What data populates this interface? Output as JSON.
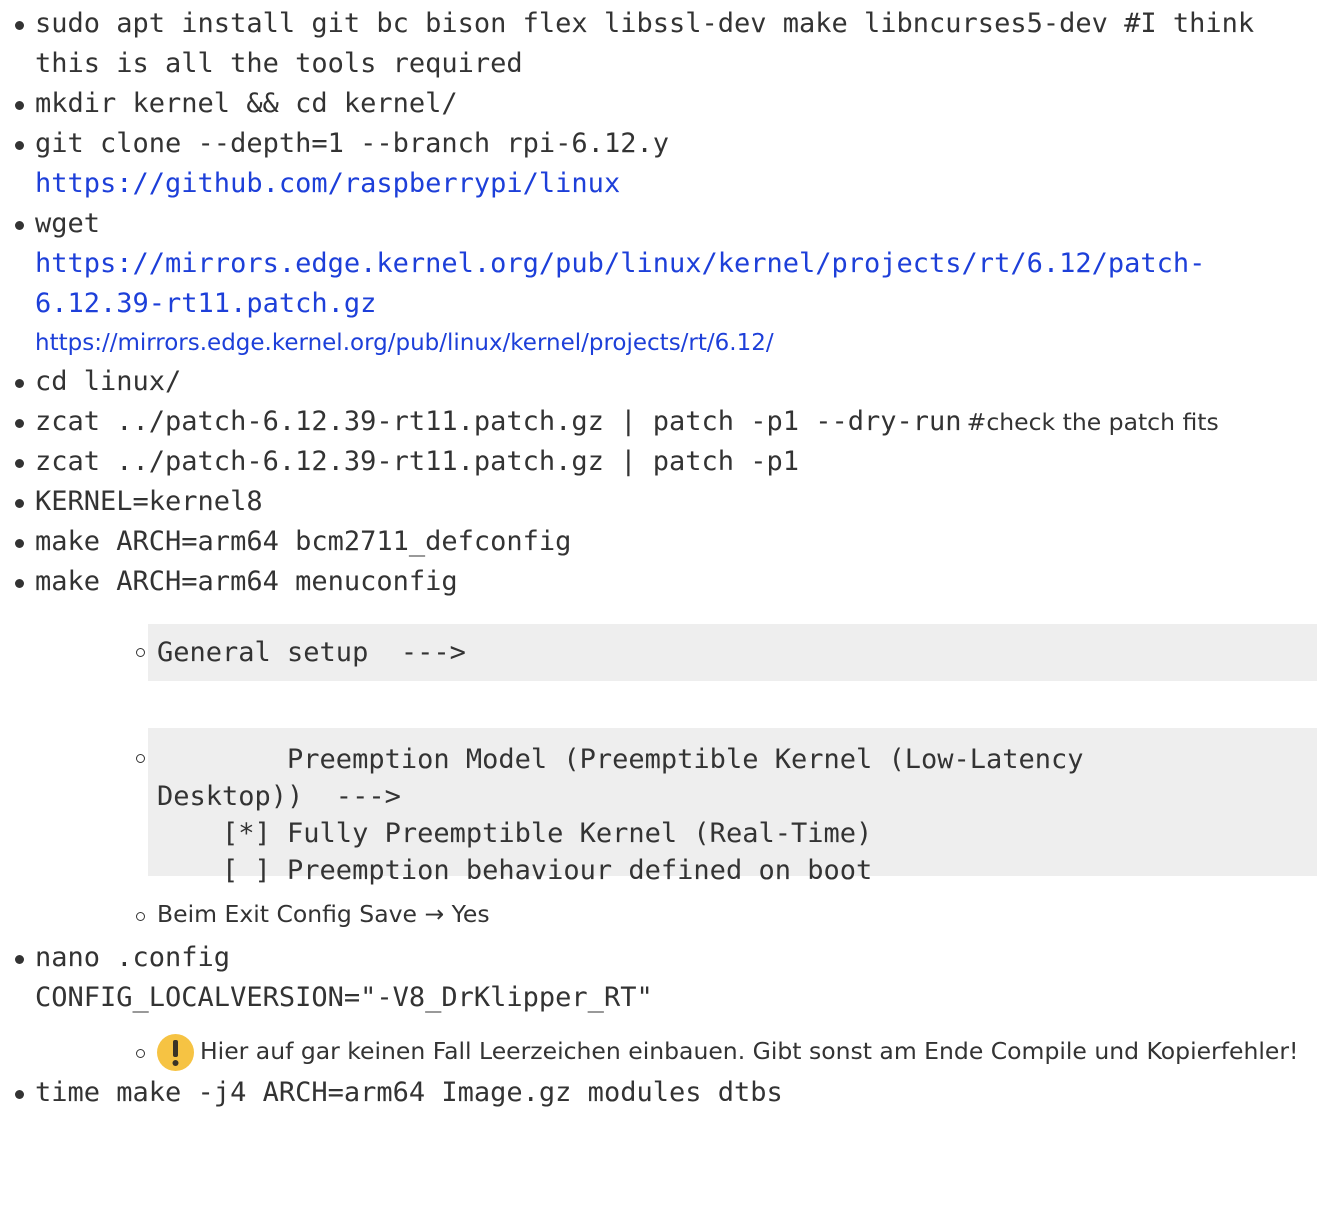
{
  "colors": {
    "link": "#1d3fd9",
    "text": "#333333",
    "code_bg": "#eeeeee",
    "warning_icon": "#f6c343"
  },
  "steps": [
    {
      "text": "sudo apt install git bc bison flex libssl-dev make libncurses5-dev #I think this is all the tools required"
    },
    {
      "text": "mkdir kernel && cd kernel/"
    },
    {
      "text": "git clone --depth=1 --branch rpi-6.12.y",
      "link": "https://github.com/raspberrypi/linux"
    },
    {
      "text": "wget",
      "link": "https://mirrors.edge.kernel.org/pub/linux/kernel/projects/rt/6.12/patch-6.12.39-rt11.patch.gz",
      "link2": "https://mirrors.edge.kernel.org/pub/linux/kernel/projects/rt/6.12/"
    },
    {
      "text": "cd linux/"
    },
    {
      "text": "zcat ../patch-6.12.39-rt11.patch.gz | patch -p1 --dry-run",
      "comment": "#check the patch fits"
    },
    {
      "text": "zcat ../patch-6.12.39-rt11.patch.gz | patch -p1"
    },
    {
      "text": "KERNEL=kernel8"
    },
    {
      "text": "make ARCH=arm64 bcm2711_defconfig"
    },
    {
      "text": "make ARCH=arm64 menuconfig"
    },
    {
      "text": "nano .config",
      "line2": "CONFIG_LOCALVERSION=\"-V8_DrKlipper_RT\""
    },
    {
      "text": "time make -j4 ARCH=arm64 Image.gz modules dtbs"
    }
  ],
  "menuconfig": {
    "general_setup": "General setup  --->",
    "preemption_line1": "        Preemption Model (Preemptible Kernel (Low-Latency",
    "preemption_line2": "Desktop))  --->",
    "option_rt": "    [*] Fully Preemptible Kernel (Real-Time)",
    "option_boot": "    [ ] Preemption behaviour defined on boot",
    "exit_note": "Beim Exit Config Save → Yes"
  },
  "config_warning": {
    "icon": "exclamation-warning-icon",
    "text": "Hier auf gar keinen Fall Leerzeichen einbauen. Gibt sonst am Ende Compile und Kopierfehler!"
  }
}
